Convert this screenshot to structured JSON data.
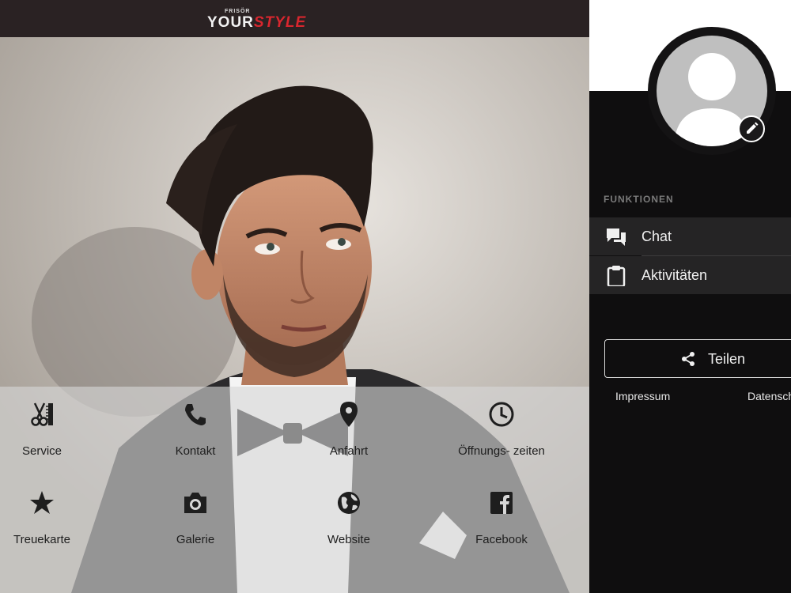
{
  "header": {
    "logo_small": "FRISÖR",
    "logo_your": "YOUR",
    "logo_style": "STYLE"
  },
  "tiles": [
    {
      "label": "Service",
      "icon": "scissors-comb-icon"
    },
    {
      "label": "Kontakt",
      "icon": "phone-icon"
    },
    {
      "label": "Anfahrt",
      "icon": "map-pin-icon"
    },
    {
      "label": "Öffnungs- zeiten",
      "icon": "clock-icon"
    },
    {
      "label": "Treuekarte",
      "icon": "star-icon"
    },
    {
      "label": "Galerie",
      "icon": "camera-icon"
    },
    {
      "label": "Website",
      "icon": "globe-icon"
    },
    {
      "label": "Facebook",
      "icon": "facebook-icon"
    }
  ],
  "drawer": {
    "section_title": "FUNKTIONEN",
    "items": [
      {
        "label": "Chat",
        "icon": "chat-icon"
      },
      {
        "label": "Aktivitäten",
        "icon": "clipboard-icon"
      }
    ],
    "share_label": "Teilen",
    "footer": {
      "impressum": "Impressum",
      "datenschutz": "Datensch"
    }
  },
  "colors": {
    "brand_red": "#d8262e",
    "topbar": "#2a2223",
    "drawer_bg": "#0f0e0f",
    "menu_item_bg": "#252425"
  }
}
